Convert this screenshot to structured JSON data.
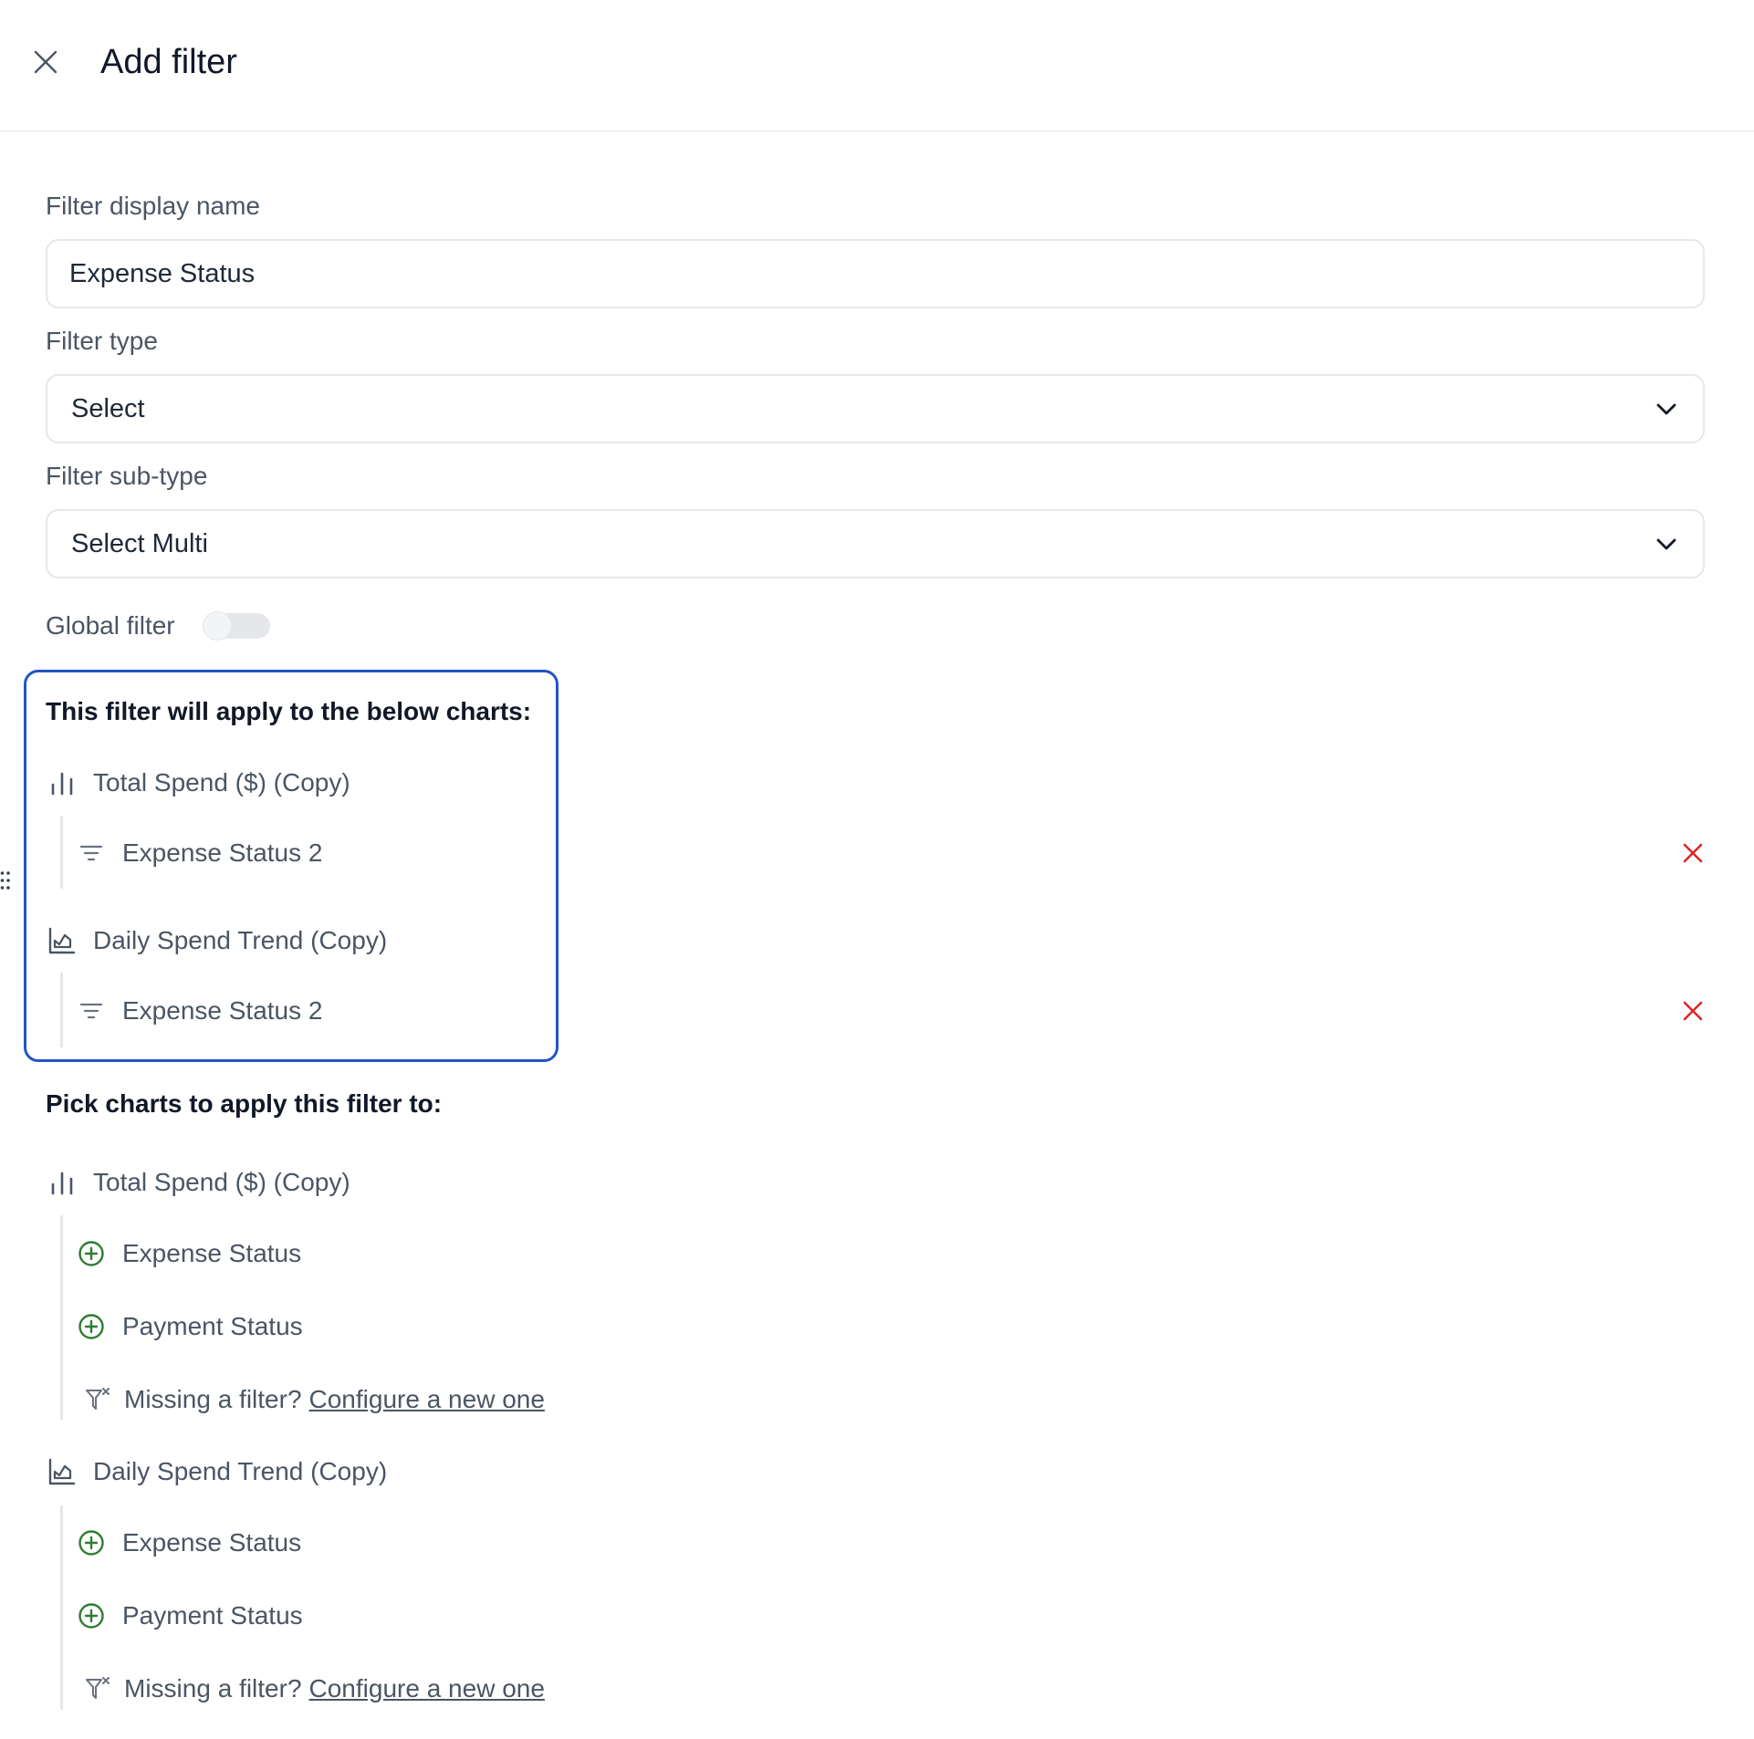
{
  "header": {
    "title": "Add filter"
  },
  "form": {
    "display_name_label": "Filter display name",
    "display_name_value": "Expense Status",
    "type_label": "Filter type",
    "type_value": "Select",
    "subtype_label": "Filter sub-type",
    "subtype_value": "Select Multi",
    "global_filter_label": "Global filter",
    "global_filter_on": false
  },
  "applied": {
    "title": "This filter will apply to the below charts:",
    "charts": [
      {
        "name": "Total Spend ($) (Copy)",
        "icon": "bar-chart-icon",
        "filter": "Expense Status 2"
      },
      {
        "name": "Daily Spend Trend (Copy)",
        "icon": "area-chart-icon",
        "filter": "Expense Status 2"
      }
    ]
  },
  "pick": {
    "title": "Pick charts to apply this filter to:",
    "charts": [
      {
        "name": "Total Spend ($) (Copy)",
        "icon": "bar-chart-icon",
        "options": [
          "Expense Status",
          "Payment Status"
        ],
        "missing_text": "Missing a filter?",
        "configure_link": "Configure a new one"
      },
      {
        "name": "Daily Spend Trend (Copy)",
        "icon": "area-chart-icon",
        "options": [
          "Expense Status",
          "Payment Status"
        ],
        "missing_text": "Missing a filter?",
        "configure_link": "Configure a new one"
      }
    ]
  },
  "colors": {
    "accent": "#2255c4",
    "add": "#2e7d32",
    "remove": "#dc2626",
    "muted": "#4b5563"
  }
}
